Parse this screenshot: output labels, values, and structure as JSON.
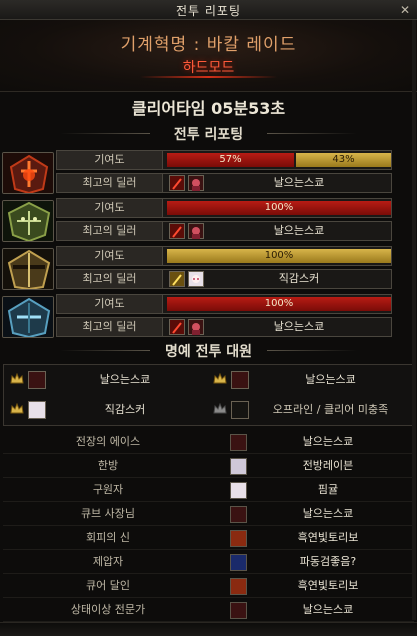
{
  "window": {
    "title": "전투 리포팅"
  },
  "header": {
    "raid_name": "기계혁명 : 바칼 레이드",
    "mode": "하드모드"
  },
  "clear_time": "클리어타임   05분53초",
  "sections": {
    "report": "전투 리포팅",
    "honor": "명예 전투 대원"
  },
  "labels": {
    "contribution": "기여도",
    "best_dealer": "최고의 딜러"
  },
  "members": [
    {
      "portrait": "red-mask-portrait",
      "bars": [
        {
          "color": "red",
          "value": 57,
          "label": "57%"
        },
        {
          "color": "gold",
          "value": 43,
          "label": "43%"
        }
      ],
      "dealer_icon": "red-sword-icon",
      "dealer_name": "날으는스쿄"
    },
    {
      "portrait": "green-armor-portrait",
      "bars": [
        {
          "color": "red",
          "value": 100,
          "label": "100%"
        }
      ],
      "dealer_icon": "red-sword-icon",
      "dealer_name": "날으는스쿄"
    },
    {
      "portrait": "gold-helm-portrait",
      "bars": [
        {
          "color": "gold",
          "value": 100,
          "label": "100%"
        }
      ],
      "dealer_icon": "gold-sword-icon",
      "dealer_name": "직감스커"
    },
    {
      "portrait": "blue-armor-portrait",
      "bars": [
        {
          "color": "red",
          "value": 100,
          "label": "100%"
        }
      ],
      "dealer_icon": "red-sword-icon",
      "dealer_name": "날으는스쿄"
    }
  ],
  "honor": [
    {
      "name": "날으는스쿄",
      "crown": "gold-crown-icon"
    },
    {
      "name": "날으는스쿄",
      "crown": "gold-crown-icon"
    },
    {
      "name": "직감스커",
      "crown": "gold-crown-icon"
    },
    {
      "name": "오프라인 / 클리어 미충족",
      "crown": "gray-crown-icon"
    }
  ],
  "titles": [
    {
      "title": "전장의 에이스",
      "name": "날으는스쿄"
    },
    {
      "title": "한방",
      "name": "전방레이븐"
    },
    {
      "title": "구원자",
      "name": "핌귤"
    },
    {
      "title": "큐브 사장님",
      "name": "날으는스쿄"
    },
    {
      "title": "회피의 신",
      "name": "흑연빛토리보"
    },
    {
      "title": "제압자",
      "name": "파동검좋음?"
    },
    {
      "title": "큐어 달인",
      "name": "흑연빛토리보"
    },
    {
      "title": "상태이상 전문가",
      "name": "날으는스쿄"
    }
  ],
  "colors": {
    "accent_red": "#b81c14",
    "accent_gold": "#d8b44a",
    "mode": "#ff5a3a",
    "raid_name": "#e0a06a"
  }
}
